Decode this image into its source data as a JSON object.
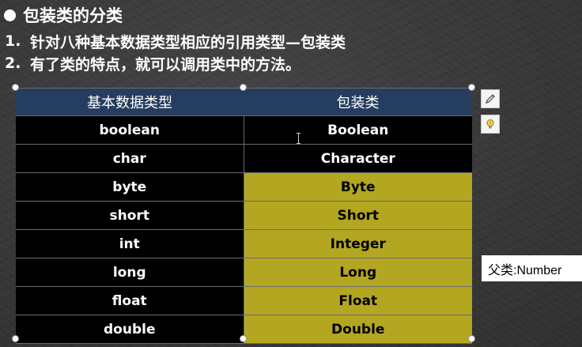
{
  "slide": {
    "title": "包装类的分类",
    "points": [
      {
        "num": "1.",
        "text": "针对八种基本数据类型相应的引用类型—包装类"
      },
      {
        "num": "2.",
        "text": "有了类的特点，就可以调用类中的方法。"
      }
    ]
  },
  "table": {
    "headers": [
      "基本数据类型",
      "包装类"
    ],
    "rows": [
      {
        "primitive": "boolean",
        "wrapper": "Boolean",
        "highlight": false
      },
      {
        "primitive": "char",
        "wrapper": "Character",
        "highlight": false
      },
      {
        "primitive": "byte",
        "wrapper": "Byte",
        "highlight": true
      },
      {
        "primitive": "short",
        "wrapper": "Short",
        "highlight": true
      },
      {
        "primitive": "int",
        "wrapper": "Integer",
        "highlight": true
      },
      {
        "primitive": "long",
        "wrapper": "Long",
        "highlight": true
      },
      {
        "primitive": "float",
        "wrapper": "Float",
        "highlight": true
      },
      {
        "primitive": "double",
        "wrapper": "Double",
        "highlight": true
      }
    ]
  },
  "note": {
    "text": "父类:Number"
  },
  "colors": {
    "header_bg": "#253d5e",
    "primitive_bg": "#000000",
    "highlight_bg": "#b3a621"
  },
  "side_buttons": {
    "edit_icon": "pencil-icon",
    "idea_icon": "lightbulb-icon"
  }
}
